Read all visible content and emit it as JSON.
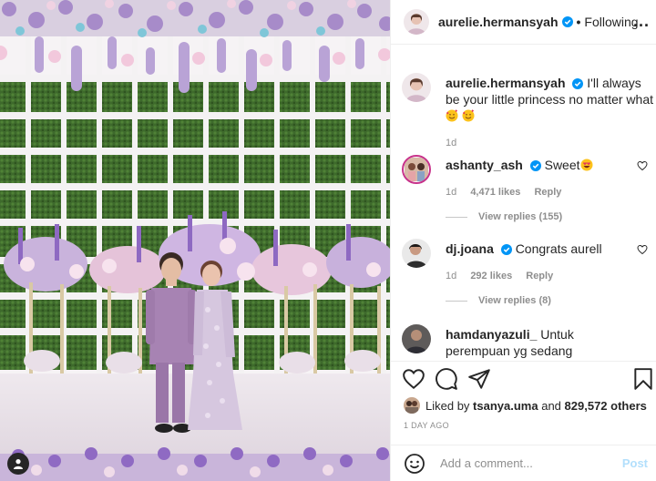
{
  "post": {
    "author": "aurelie.hermansyah",
    "dot": "•",
    "follow_status": "Following",
    "more_label": "...",
    "caption": "I'll always be your little princess no matter what",
    "caption_age": "1d"
  },
  "comments": [
    {
      "username": "ashanty_ash",
      "text": "Sweet",
      "age": "1d",
      "likes": "4,471 likes",
      "reply": "Reply",
      "view_replies": "View replies (155)"
    },
    {
      "username": "dj.joana",
      "text": "Congrats aurell",
      "age": "1d",
      "likes": "292 likes",
      "reply": "Reply",
      "view_replies": "View replies (8)"
    },
    {
      "username": "hamdanyazuli_",
      "text": "Untuk perempuan yg sedang membaca"
    }
  ],
  "likes": {
    "prefix": "Liked by",
    "first_liker": "tsanya.uma",
    "connector": "and",
    "others": "829,572 others"
  },
  "time_ago": "1 DAY AGO",
  "add_comment": {
    "placeholder": "Add a comment...",
    "post_label": "Post"
  },
  "colors": {
    "verified": "#0095f6",
    "post_disabled": "#b2dffc",
    "muted": "#8e8e8e"
  },
  "icons": [
    "heart-icon",
    "comment-icon",
    "share-icon",
    "bookmark-icon",
    "smile-icon",
    "verified-icon",
    "user-tag-icon"
  ]
}
